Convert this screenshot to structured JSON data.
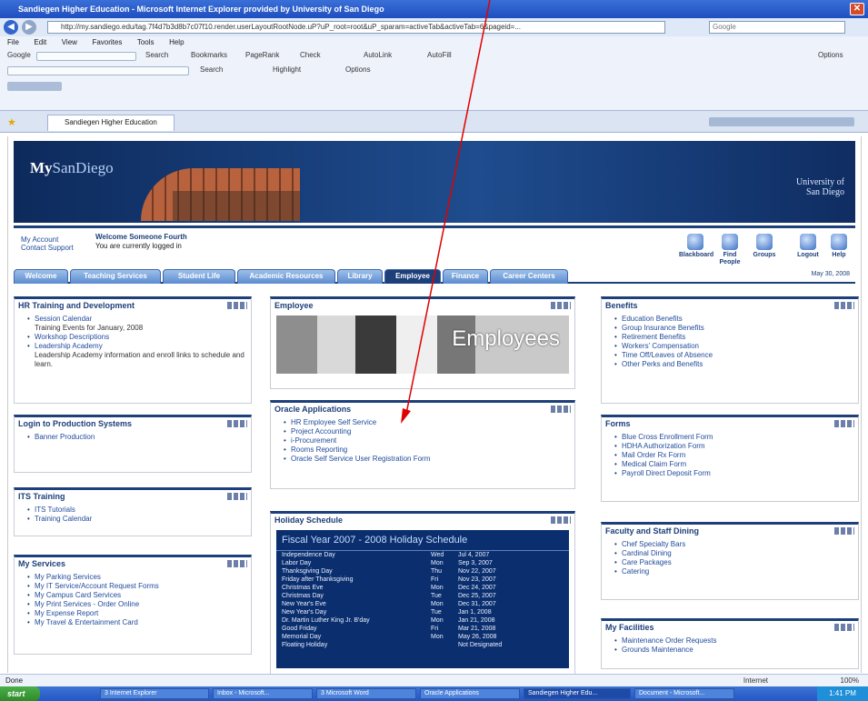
{
  "browser": {
    "title": "Sandiegen Higher Education - Microsoft Internet Explorer provided by University of San Diego",
    "url": "http://my.sandiego.edu/tag.7f4d7b3d8b7c07f10.render.userLayoutRootNode.uP?uP_root=root&uP_sparam=activeTab&activeTab=6&pageid=...",
    "search_placeholder": "Google",
    "menu": [
      "File",
      "Edit",
      "View",
      "Favorites",
      "Tools",
      "Help"
    ],
    "tab_label": "Sandiegen Higher Education",
    "toolbar_text": [
      "Google",
      "Search",
      "Bookmarks",
      "PageRank",
      "Check",
      "AutoLink",
      "AutoFill",
      "Options"
    ],
    "toolbar2_text": [
      "Search",
      "Highlight",
      "Options"
    ],
    "status_text": "Done",
    "zone_text": "Internet",
    "zoom_text": "100%"
  },
  "banner": {
    "logo_my": "My",
    "logo_rest": "SanDiego",
    "university_logo": "University of San Diego"
  },
  "welcome": {
    "side_line1": "My Account",
    "side_line2": "Contact Support",
    "heading": "Welcome Someone Fourth",
    "subtext": "You are currently logged in"
  },
  "quick_icons": [
    "Blackboard",
    "Find People",
    "Groups",
    "Logout",
    "Help"
  ],
  "nav_tabs": [
    "Welcome",
    "Teaching Services",
    "Student Life",
    "Academic Resources",
    "Library",
    "Employee",
    "Finance",
    "Career Centers"
  ],
  "nav_date": "May 30, 2008",
  "panels": {
    "hr": {
      "title": "HR Training and Development",
      "items": [
        {
          "label": "Session Calendar",
          "sub": "Training Events for January, 2008"
        },
        {
          "label": "Workshop Descriptions",
          "sub": ""
        },
        {
          "label": "Leadership Academy",
          "sub": "Leadership Academy information and enroll links to schedule and learn."
        }
      ]
    },
    "login": {
      "title": "Login to Production Systems",
      "items": [
        "Banner Production"
      ]
    },
    "its": {
      "title": "ITS Training",
      "items": [
        "ITS Tutorials",
        "Training Calendar"
      ]
    },
    "myservices": {
      "title": "My Services",
      "items": [
        "My Parking Services",
        "My IT Service/Account Request Forms",
        "My Campus Card Services",
        "My Print Services - Order Online",
        "My Expense Report",
        "My Travel & Entertainment Card"
      ]
    },
    "employee": {
      "title": "Employee",
      "image_text": "Employees"
    },
    "oracle": {
      "title": "Oracle Applications",
      "items": [
        "HR Employee Self Service",
        "Project Accounting",
        "i-Procurement",
        "Rooms Reporting",
        "Oracle Self Service User Registration Form"
      ]
    },
    "holiday": {
      "title": "Holiday Schedule",
      "box_title": "Fiscal Year 2007 - 2008 Holiday Schedule",
      "rows": [
        {
          "name": "Independence Day",
          "day": "Wed",
          "date": "Jul 4, 2007"
        },
        {
          "name": "Labor Day",
          "day": "Mon",
          "date": "Sep 3, 2007"
        },
        {
          "name": "Thanksgiving Day",
          "day": "Thu",
          "date": "Nov 22, 2007"
        },
        {
          "name": "Friday after Thanksgiving",
          "day": "Fri",
          "date": "Nov 23, 2007"
        },
        {
          "name": "Christmas Eve",
          "day": "Mon",
          "date": "Dec 24, 2007"
        },
        {
          "name": "Christmas Day",
          "day": "Tue",
          "date": "Dec 25, 2007"
        },
        {
          "name": "New Year's Eve",
          "day": "Mon",
          "date": "Dec 31, 2007"
        },
        {
          "name": "New Year's Day",
          "day": "Tue",
          "date": "Jan 1, 2008"
        },
        {
          "name": "Dr. Martin Luther King Jr. B'day",
          "day": "Mon",
          "date": "Jan 21, 2008"
        },
        {
          "name": "Good Friday",
          "day": "Fri",
          "date": "Mar 21, 2008"
        },
        {
          "name": "Memorial Day",
          "day": "Mon",
          "date": "May 26, 2008"
        },
        {
          "name": "Floating Holiday",
          "day": "",
          "date": "Not Designated"
        }
      ]
    },
    "benefits": {
      "title": "Benefits",
      "items": [
        "Education Benefits",
        "Group Insurance Benefits",
        "Retirement Benefits",
        "Workers' Compensation",
        "Time Off/Leaves of Absence",
        "Other Perks and Benefits"
      ]
    },
    "forms": {
      "title": "Forms",
      "items": [
        "Blue Cross Enrollment Form",
        "HDHA Authorization Form",
        "Mail Order Rx Form",
        "Medical Claim Form",
        "Payroll Direct Deposit Form"
      ]
    },
    "dining": {
      "title": "Faculty and Staff Dining",
      "items": [
        "Chef Specialty Bars",
        "Cardinal Dining",
        "Care Packages",
        "Catering"
      ]
    },
    "facilities": {
      "title": "My Facilities",
      "items": [
        "Maintenance Order Requests",
        "Grounds Maintenance"
      ]
    }
  },
  "taskbar": {
    "start": "start",
    "items": [
      "3 Internet Explorer",
      "Inbox - Microsoft...",
      "3 Microsoft Word",
      "Oracle Applications",
      "Sandiegen Higher Edu...",
      "Document - Microsoft..."
    ],
    "clock": "1:41 PM"
  },
  "colors": {
    "brand_navy": "#1d3f7a",
    "link_blue": "#1f4a9c",
    "annotation_arrow": "#e00000"
  }
}
